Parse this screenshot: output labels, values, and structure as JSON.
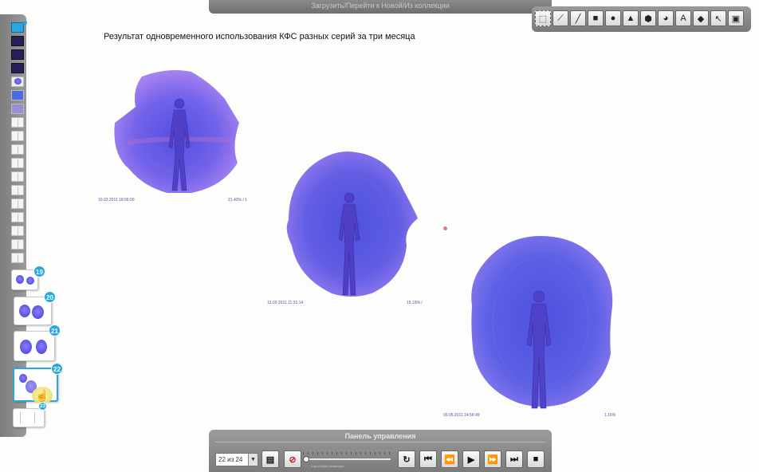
{
  "top_bar": {
    "text": "Загрузить/Перейти к Новой/Из коллекции"
  },
  "toolbar": {
    "tools": [
      {
        "name": "select-rect-icon",
        "glyph": "⬚"
      },
      {
        "name": "pen-icon",
        "glyph": "⟋"
      },
      {
        "name": "line-icon",
        "glyph": "╱"
      },
      {
        "name": "square-icon",
        "glyph": "■"
      },
      {
        "name": "circle-icon",
        "glyph": "●"
      },
      {
        "name": "triangle-icon",
        "glyph": "▲"
      },
      {
        "name": "hexagon-icon",
        "glyph": "⬢"
      },
      {
        "name": "pie-icon",
        "glyph": "◕"
      },
      {
        "name": "text-icon",
        "glyph": "A"
      },
      {
        "name": "eraser-icon",
        "glyph": "◆"
      },
      {
        "name": "pointer-icon",
        "glyph": "↖"
      },
      {
        "name": "save-icon",
        "glyph": "▣"
      }
    ]
  },
  "slide": {
    "title": "Результат  одновременного использования КФС разных серий за три месяца",
    "figures": [
      {
        "date": "10.02.2011 18:06:00",
        "value": "21.43% / 1"
      },
      {
        "date": "13.03.2011 11:31:14",
        "value": "15.15% /"
      },
      {
        "date": "09.05.2011 14:56:49",
        "value": "1.16%"
      }
    ]
  },
  "thumbnails": {
    "badges": [
      "19",
      "20",
      "21",
      "22",
      "23"
    ]
  },
  "control_panel": {
    "title": "Панель управления",
    "page_select": "22 из 24",
    "slider_caption": "Ход слайда Анимация",
    "slider_position": 0.0
  },
  "colors": {
    "aura_outer": "#7b6cf2",
    "aura_inner": "#3f43d8",
    "figure": "#5b4bd0",
    "accent": "#29a8df",
    "panel": "#8a8a8a"
  }
}
